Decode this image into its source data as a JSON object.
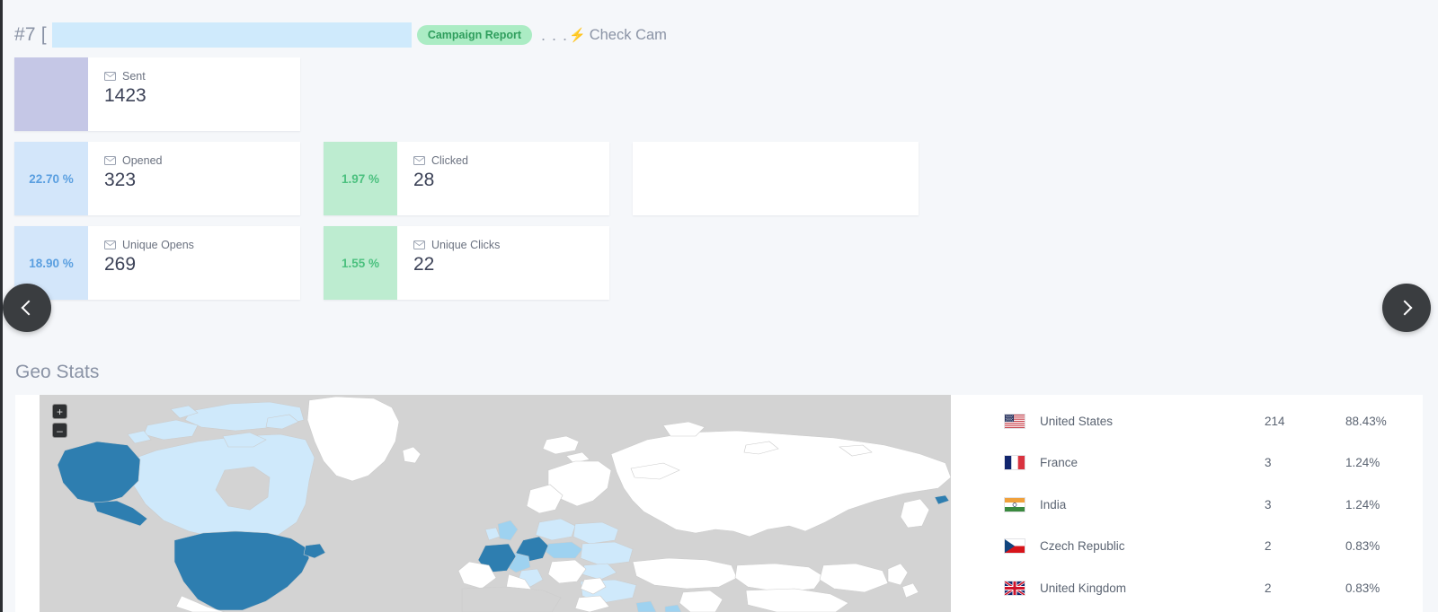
{
  "header": {
    "index_label": "#7 [",
    "title_redacted": "",
    "badge": "Campaign Report",
    "dots": ". . .",
    "bolt_icon": "bolt-icon",
    "check_link": "Check Cam"
  },
  "stats": {
    "cards": [
      {
        "pct": "",
        "label": "Sent",
        "value": "1423",
        "style": "sent",
        "icon": "envelope-icon"
      },
      {
        "pct": "22.70 %",
        "label": "Opened",
        "value": "323",
        "style": "blue",
        "icon": "envelope-icon"
      },
      {
        "pct": "1.97 %",
        "label": "Clicked",
        "value": "28",
        "style": "green",
        "icon": "envelope-icon"
      },
      {
        "pct": "18.90 %",
        "label": "Unique Opens",
        "value": "269",
        "style": "blue",
        "icon": "envelope-icon"
      },
      {
        "pct": "1.55 %",
        "label": "Unique Clicks",
        "value": "22",
        "style": "green",
        "icon": "envelope-icon"
      }
    ]
  },
  "carousel": {
    "prev_icon": "chevron-left-icon",
    "next_icon": "chevron-right-icon"
  },
  "geo": {
    "title": "Geo Stats",
    "map": {
      "zoom_in": "+",
      "zoom_out": "–",
      "highlight_dark": "#2e7eb0",
      "highlight_light": "#cfe9fb",
      "land": "#ffffff",
      "ocean": "#d3d3d3"
    },
    "countries": [
      {
        "flag": "flag-us",
        "name": "United States",
        "count": "214",
        "percent": "88.43%"
      },
      {
        "flag": "flag-fr",
        "name": "France",
        "count": "3",
        "percent": "1.24%"
      },
      {
        "flag": "flag-in",
        "name": "India",
        "count": "3",
        "percent": "1.24%"
      },
      {
        "flag": "flag-cz",
        "name": "Czech Republic",
        "count": "2",
        "percent": "0.83%"
      },
      {
        "flag": "flag-gb",
        "name": "United Kingdom",
        "count": "2",
        "percent": "0.83%"
      }
    ]
  },
  "colors": {
    "page_bg": "#f5f7fa",
    "badge_bg": "#abecc4",
    "badge_text": "#2f9e5d",
    "blue_block": "#d3e6fa",
    "blue_text": "#5a9fe0",
    "green_block": "#bdecd0",
    "green_text": "#4cc17f",
    "sent_block": "#c5c7e6",
    "redact": "#cfeafc"
  }
}
